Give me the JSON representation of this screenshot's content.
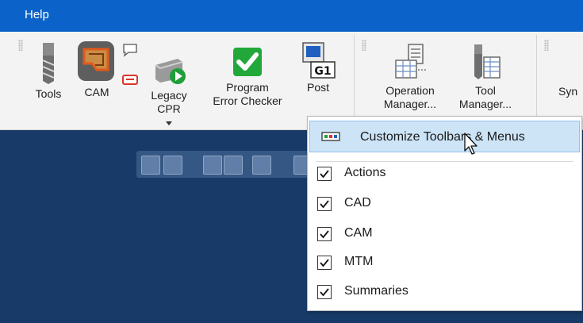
{
  "menubar": {
    "help_label": "Help"
  },
  "ribbon": {
    "group1": {
      "tools_label": "Tools",
      "cam_label": "CAM",
      "legacy_cpr_line1": "Legacy",
      "legacy_cpr_line2": "CPR",
      "program_error_checker_line1": "Program",
      "program_error_checker_line2": "Error Checker",
      "post_label": "Post",
      "post_icon_text": "G1"
    },
    "group2": {
      "operation_manager_line1": "Operation",
      "operation_manager_line2": "Manager...",
      "tool_manager_line1": "Tool",
      "tool_manager_line2": "Manager..."
    },
    "group3": {
      "sync_partial": "Syn"
    }
  },
  "context_menu": {
    "customize_label": "Customize Toolbars & Menus",
    "items": [
      {
        "label": "Actions",
        "checked": true
      },
      {
        "label": "CAD",
        "checked": true
      },
      {
        "label": "CAM",
        "checked": true
      },
      {
        "label": "MTM",
        "checked": true
      },
      {
        "label": "Summaries",
        "checked": true
      }
    ]
  },
  "colors": {
    "menubar": "#0b63c9",
    "workspace": "#173a68",
    "highlight": "#cde4f7",
    "check_green": "#22a83a"
  }
}
